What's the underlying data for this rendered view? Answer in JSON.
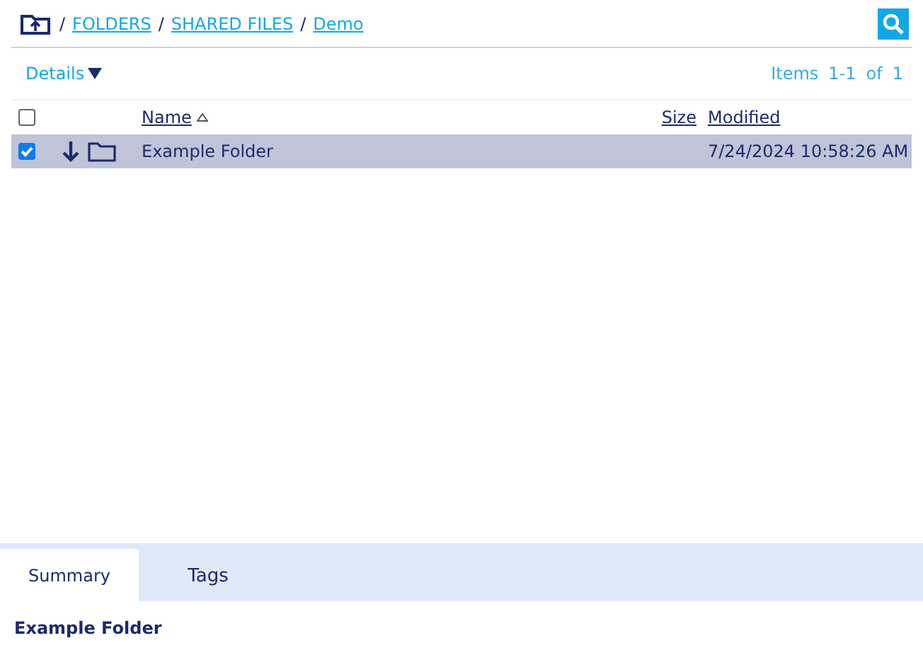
{
  "breadcrumb": [
    {
      "separator": "/",
      "label": "FOLDERS"
    },
    {
      "separator": "/",
      "label": "SHARED FILES"
    },
    {
      "separator": "/",
      "label": "Demo"
    }
  ],
  "view_menu": {
    "label": "Details"
  },
  "pager": {
    "items_label": "Items",
    "range": "1-1",
    "of_label": "of",
    "total": "1"
  },
  "table": {
    "select_all": {
      "checked": false
    },
    "columns": [
      {
        "label": "Name",
        "sorted": true
      },
      {
        "label": "Size",
        "sorted": false
      },
      {
        "label": "Modified",
        "sorted": false
      }
    ],
    "rows": [
      {
        "selected": true,
        "checked": true,
        "name": "Example Folder",
        "size": "",
        "modified": "7/24/2024 10:58:26 AM"
      }
    ]
  },
  "tabs": [
    {
      "label": "Summary",
      "selected": true
    },
    {
      "label": "Tags",
      "selected": false
    }
  ],
  "summary": {
    "title": "Example Folder"
  }
}
